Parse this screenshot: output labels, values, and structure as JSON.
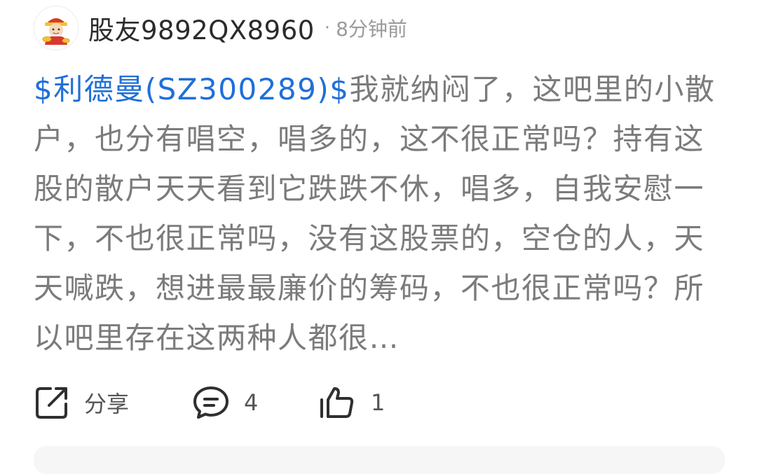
{
  "post": {
    "author": "股友9892QX8960",
    "separator": "·",
    "time": "8分钟前",
    "stock_tag": "$利德曼(SZ300289)$",
    "text": "我就纳闷了，这吧里的小散户，也分有唱空，唱多的，这不很正常吗？持有这股的散户天天看到它跌跌不休，唱多，自我安慰一下，不也很正常吗，没有这股票的，空仓的人，天天喊跌，想进最最廉价的筹码，不也很正常吗？所以吧里存在这两种人都很…"
  },
  "actions": {
    "share_label": "分享",
    "comment_count": "4",
    "like_count": "1"
  },
  "colors": {
    "link": "#1f6fd8",
    "body_text": "#7b7b7b",
    "author_text": "#2b2b2b",
    "meta_text": "#9a9a9a"
  },
  "icons": {
    "avatar": "cartoon-mascot-avatar",
    "share": "share-icon",
    "comment": "comment-icon",
    "like": "thumbs-up-icon"
  }
}
